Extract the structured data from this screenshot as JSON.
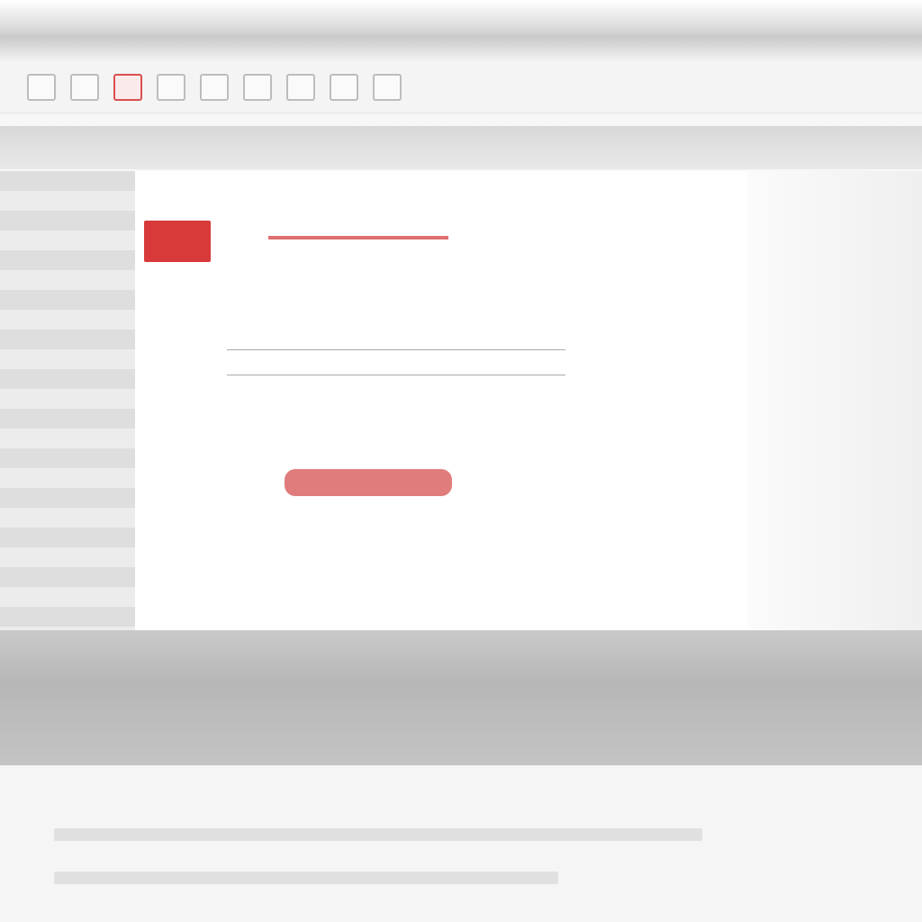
{
  "window": {
    "title": ""
  },
  "toolbar": {
    "items": [
      {
        "icon": "page-icon",
        "accent": false
      },
      {
        "icon": "print-icon",
        "accent": false
      },
      {
        "icon": "mail-icon",
        "accent": true
      },
      {
        "icon": "folder-icon",
        "accent": false
      },
      {
        "icon": "doc-icon",
        "accent": false
      },
      {
        "icon": "edit-icon",
        "accent": false
      },
      {
        "icon": "search-icon",
        "accent": false
      },
      {
        "icon": "settings-icon",
        "accent": false
      },
      {
        "icon": "help-icon",
        "accent": false
      }
    ]
  },
  "form": {
    "rows": [
      {
        "label": "",
        "value": ""
      },
      {
        "label": "",
        "value": ""
      },
      {
        "label": "",
        "value": ""
      },
      {
        "label": "",
        "value": ""
      }
    ],
    "tag_label": "",
    "title": "",
    "note1": "",
    "note2": "",
    "action_label": ""
  },
  "colors": {
    "accent": "#d83a3a",
    "accent_light": "#e07c7c"
  }
}
